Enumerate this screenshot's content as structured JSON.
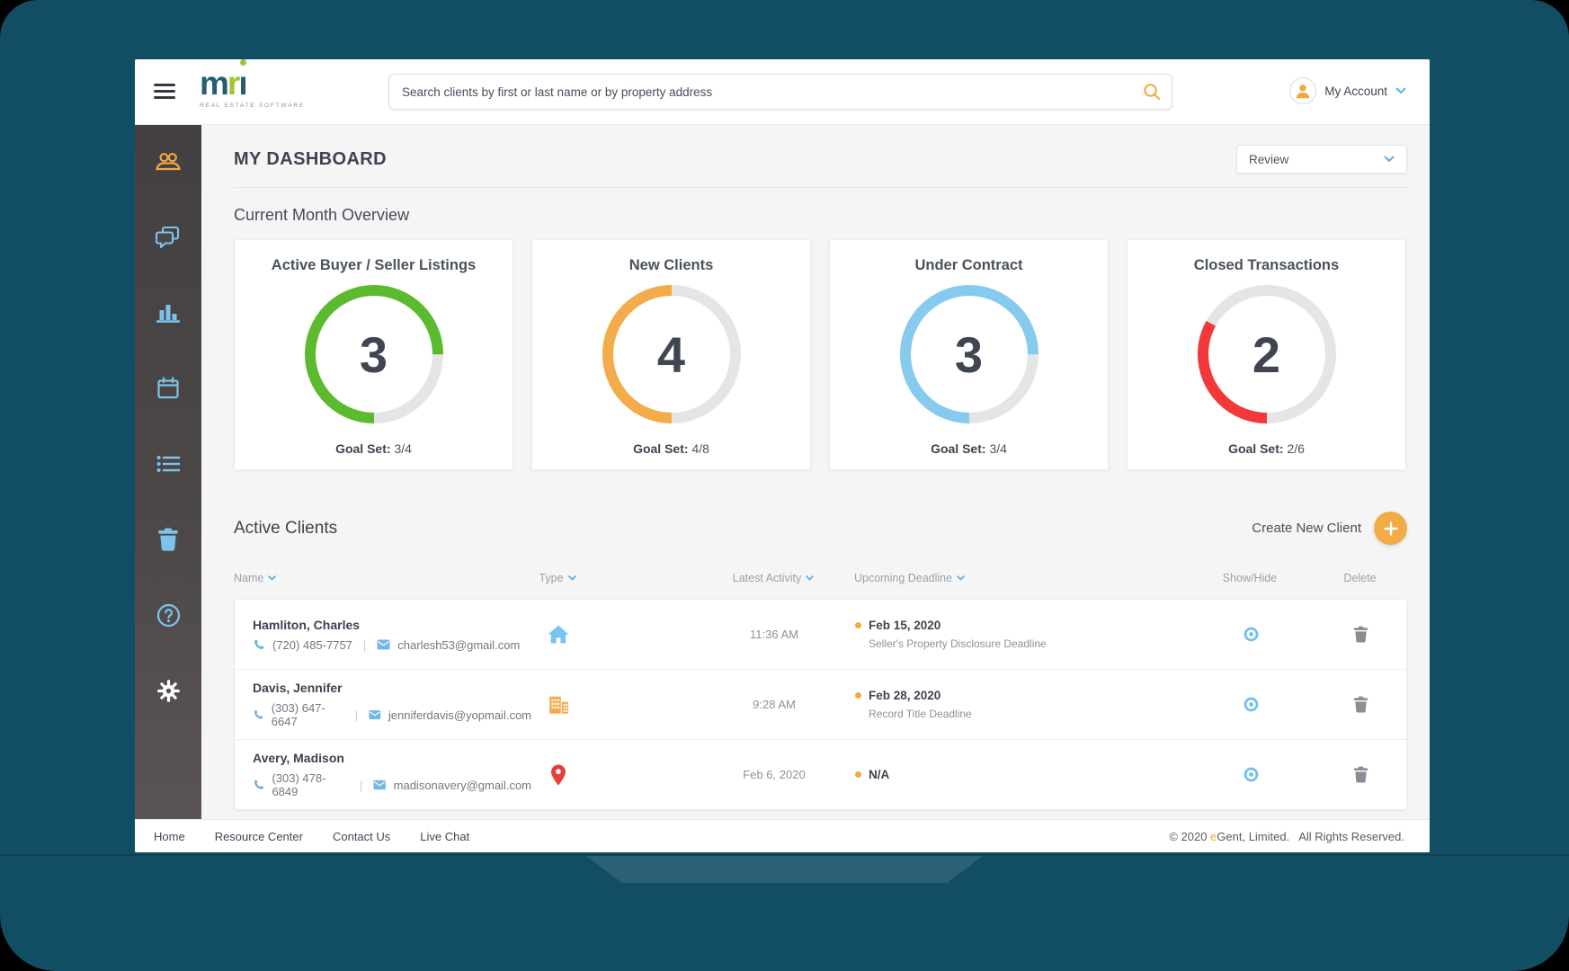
{
  "topbar": {
    "logo": {
      "m": "m",
      "r": "r",
      "i": "ı",
      "tagline": "REAL ESTATE SOFTWARE"
    },
    "search_placeholder": "Search clients by first or last name or by property address",
    "account_label": "My Account"
  },
  "page": {
    "title": "MY DASHBOARD",
    "filter_value": "Review"
  },
  "overview": {
    "heading": "Current Month Overview",
    "goal_label": "Goal Set",
    "cards": [
      {
        "title": "Active Buyer / Seller Listings",
        "value": "3",
        "goal": "3/4",
        "percent": 75,
        "color": "#5cba2e"
      },
      {
        "title": "New Clients",
        "value": "4",
        "goal": "4/8",
        "percent": 50,
        "color": "#f4ab49"
      },
      {
        "title": "Under Contract",
        "value": "3",
        "goal": "3/4",
        "percent": 75,
        "color": "#86cbee"
      },
      {
        "title": "Closed Transactions",
        "value": "2",
        "goal": "2/6",
        "percent": 33,
        "color": "#f23838"
      }
    ]
  },
  "clients": {
    "heading": "Active Clients",
    "create_label": "Create New Client",
    "columns": {
      "name": "Name",
      "type": "Type",
      "activity": "Latest Activity",
      "deadline": "Upcoming Deadline",
      "show_hide": "Show/Hide",
      "delete": "Delete"
    },
    "rows": [
      {
        "name": "Hamliton, Charles",
        "phone": "(720) 485-7757",
        "sep": "|",
        "email": "charlesh53@gmail.com",
        "type": "house",
        "activity": "11:36 AM",
        "deadline": "Feb 15, 2020",
        "deadline_note": "Seller's Property Disclosure Deadline"
      },
      {
        "name": "Davis, Jennifer",
        "phone": "(303) 647-6647",
        "sep": "|",
        "email": "jenniferdavis@yopmail.com",
        "type": "building",
        "activity": "9:28 AM",
        "deadline": "Feb 28, 2020",
        "deadline_note": "Record Title Deadline"
      },
      {
        "name": "Avery, Madison",
        "phone": "(303) 478-6849",
        "sep": "|",
        "email": "madisonavery@gmail.com",
        "type": "location-pin",
        "activity": "Feb 6, 2020",
        "deadline": "N/A",
        "deadline_note": ""
      }
    ]
  },
  "footer": {
    "links": [
      "Home",
      "Resource Center",
      "Contact Us",
      "Live Chat"
    ],
    "copyright": {
      "prefix": "© 2020 ",
      "brand_accent": "e",
      "brand_rest": "Gent, Limited.",
      "rights": "All Rights Reserved."
    }
  }
}
